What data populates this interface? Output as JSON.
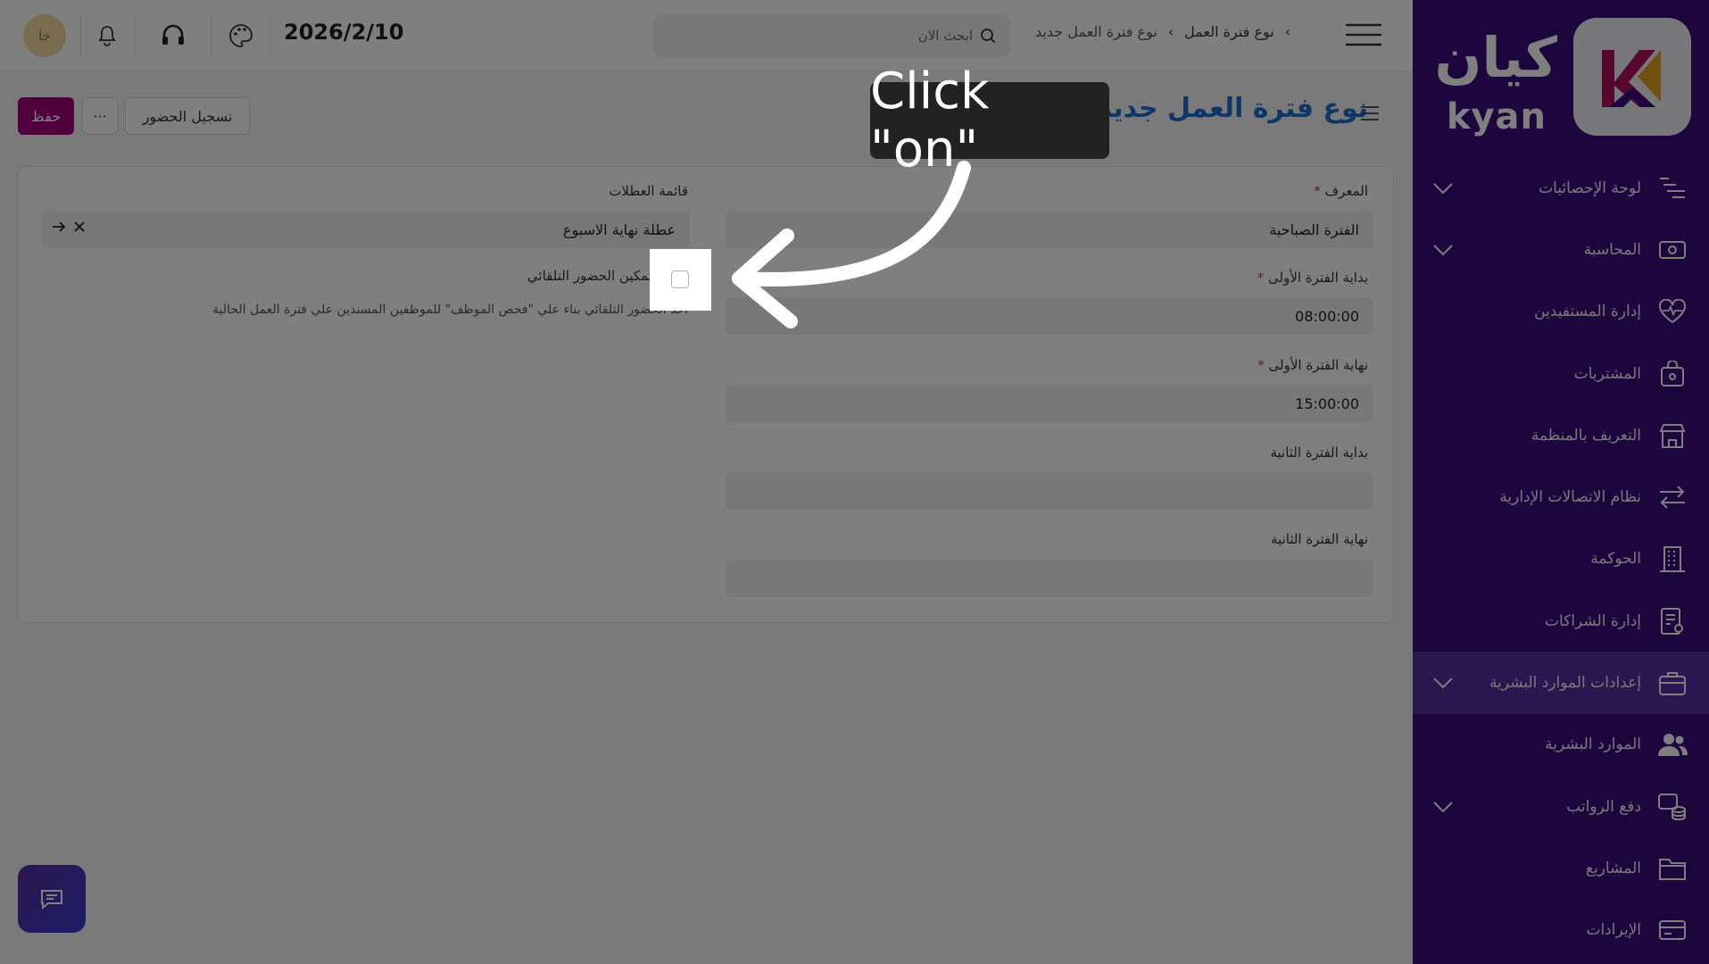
{
  "brand": {
    "name": "كيان",
    "sub": "kyan",
    "accent": "#a4007a",
    "sidebar_color": "#3a0d7a"
  },
  "topbar": {
    "breadcrumb": [
      "نوع فترة العمل",
      "نوع فترة العمل جديد"
    ],
    "search_placeholder": "ابحث الان",
    "date": "2026/2/10",
    "avatar_initials": "خا"
  },
  "sidebar": {
    "items": [
      {
        "label": "لوحة الإحصائيات",
        "icon": "chart-lines-icon",
        "chevron": true
      },
      {
        "label": "المحاسبة",
        "icon": "cash-icon",
        "chevron": true
      },
      {
        "label": "إدارة المستفيدين",
        "icon": "heart-pulse-icon",
        "chevron": false
      },
      {
        "label": "المشتريات",
        "icon": "bag-icon",
        "chevron": false
      },
      {
        "label": "التعريف بالمنظمة",
        "icon": "store-icon",
        "chevron": false
      },
      {
        "label": "نظام الاتصالات الإدارية",
        "icon": "arrows-exchange-icon",
        "chevron": false
      },
      {
        "label": "الحوكمة",
        "icon": "building-icon",
        "chevron": false
      },
      {
        "label": "إدارة الشراكات",
        "icon": "document-icon",
        "chevron": false
      },
      {
        "label": "إعدادات الموارد البشرية",
        "icon": "briefcase-icon",
        "chevron": true,
        "active": true
      },
      {
        "label": "الموارد البشرية",
        "icon": "users-icon",
        "chevron": false
      },
      {
        "label": "دفع الرواتب",
        "icon": "coins-icon",
        "chevron": true
      },
      {
        "label": "المشاريع",
        "icon": "folder-icon",
        "chevron": false
      },
      {
        "label": "الإيرادات",
        "icon": "card-icon",
        "chevron": false
      }
    ]
  },
  "page": {
    "title": "نوع فترة العمل جديد",
    "save_label": "حفظ",
    "more_label": "···",
    "attendance_label": "تسجيل الحضور"
  },
  "form": {
    "id_label": "المعرف",
    "id_value": "الفترة الصباحية",
    "start1_label": "بداية الفترة الأولى",
    "start1_value": "08:00:00",
    "end1_label": "نهاية الفترة الأولى",
    "end1_value": "15:00:00",
    "start2_label": "بداية الفترة الثانية",
    "start2_value": "",
    "end2_label": "نهاية الفترة الثانية",
    "end2_value": "",
    "holiday_label": "قائمة العطلات",
    "holiday_value": "عطلة نهاية الاسبوع",
    "auto_label": "تمكين الحضور التلقائي",
    "auto_desc": "اخذ الحضور التلقائي بناء علي \"فحص الموظف\" للموظفين المسندين علي فترة العمل الحالية"
  },
  "overlay": {
    "tooltip": "Click \"on\""
  }
}
